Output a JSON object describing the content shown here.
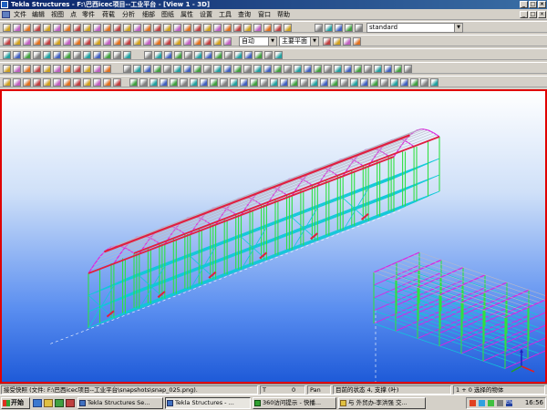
{
  "window": {
    "title": "Tekla Structures - F:\\巴西icec项目--工业平台 - [View 1 - 3D]",
    "minimize": "_",
    "restore": "□",
    "close": "×",
    "doc_minimize": "_",
    "doc_restore": "□",
    "doc_close": "×"
  },
  "menu": [
    "文件",
    "编辑",
    "视图",
    "点",
    "零件",
    "荷载",
    "分析",
    "细部",
    "图纸",
    "属性",
    "设置",
    "工具",
    "查询",
    "窗口",
    "帮助"
  ],
  "toolbar": {
    "standard_combo": "standard",
    "auto_combo": "自动",
    "plane_combo": "主要平面"
  },
  "statusbar": {
    "message": "接受快照 (文件: F:\\巴西icec项目--工业平台\\snapshots\\snap_025.png).",
    "coord_label": "T",
    "coord_value": "0",
    "mode": "Pan",
    "state": "目前的状态 4, 支撑 (叶)",
    "selection": "1 + 0 选择的物体"
  },
  "taskbar": {
    "start": "开始",
    "buttons": [
      "Tekla Structures Se...",
      "Tekla Structures - ...",
      "360访问提示 - 快播...",
      "与 外贸办-李洪强 交..."
    ],
    "clock": "16:56"
  },
  "colors": {
    "beam_magenta": "#e020e0",
    "column_green": "#30e040",
    "brace_cyan": "#10c8d8",
    "rafter_red": "#e02040",
    "purlin_gray": "#b8b8c8",
    "viewport_border": "#e00000"
  }
}
